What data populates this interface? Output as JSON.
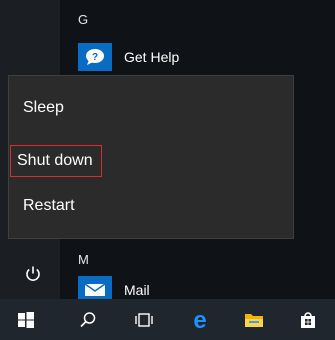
{
  "app_list": {
    "letter_g": "G",
    "letter_m": "M",
    "apps": [
      {
        "label": "Get Help",
        "icon": "help-chat-icon",
        "tile_color": "#0a6bc2"
      },
      {
        "label": "Mail",
        "icon": "mail-icon",
        "tile_color": "#0a6bc2"
      }
    ]
  },
  "power_menu": {
    "items": [
      "Sleep",
      "Shut down",
      "Restart"
    ],
    "highlighted": "Shut down",
    "highlight_color": "#d32f2f"
  },
  "left_rail": {
    "icons": [
      "power-icon"
    ]
  },
  "taskbar": {
    "icons": [
      "windows-start-icon",
      "search-icon",
      "task-view-icon",
      "edge-icon",
      "file-explorer-icon",
      "store-icon"
    ],
    "edge_color": "#1e90ff",
    "explorer_color": "#f2b400"
  }
}
